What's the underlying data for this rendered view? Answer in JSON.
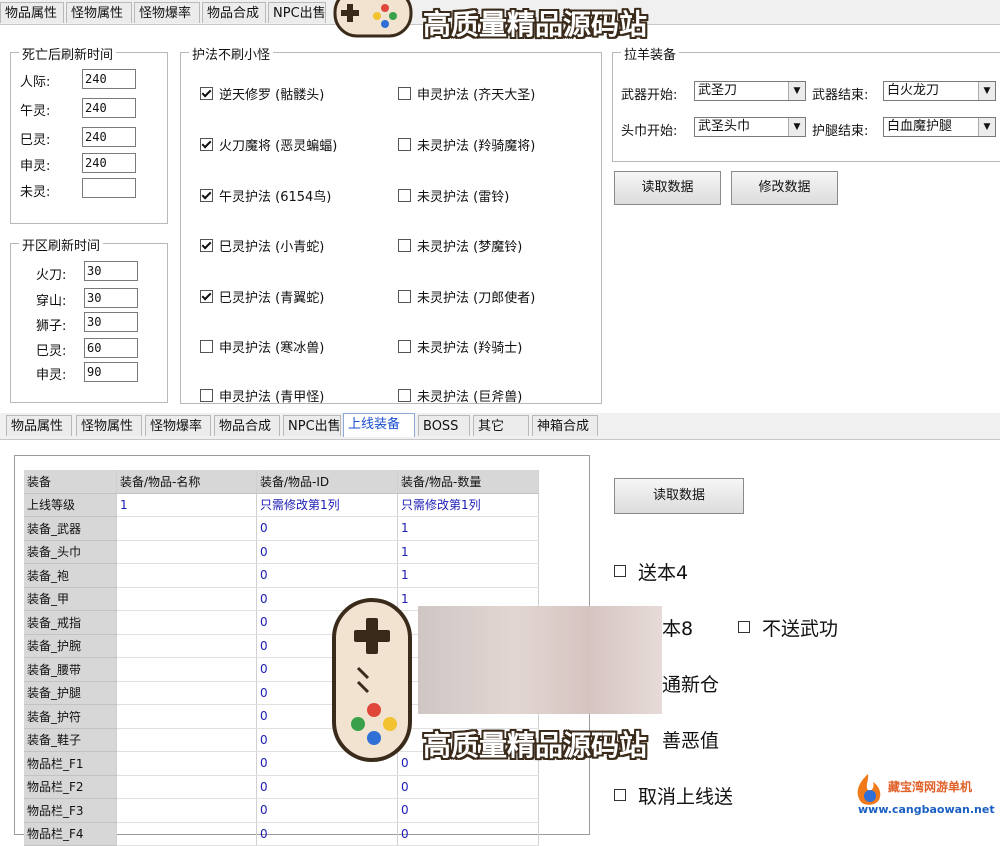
{
  "top_tabs": [
    "物品属性",
    "怪物属性",
    "怪物爆率",
    "物品合成",
    "NPC出售"
  ],
  "death_refresh": {
    "title": "死亡后刷新时间",
    "rows": [
      {
        "label": "人际:",
        "value": "240"
      },
      {
        "label": "午灵:",
        "value": "240"
      },
      {
        "label": "巳灵:",
        "value": "240"
      },
      {
        "label": "申灵:",
        "value": "240"
      },
      {
        "label": "未灵:",
        "value": ""
      }
    ]
  },
  "server_refresh": {
    "title": "开区刷新时间",
    "rows": [
      {
        "label": "火刀:",
        "value": "30"
      },
      {
        "label": "穿山:",
        "value": "30"
      },
      {
        "label": "狮子:",
        "value": "30"
      },
      {
        "label": "巳灵:",
        "value": "60"
      },
      {
        "label": "申灵:",
        "value": "90"
      }
    ]
  },
  "no_minion": {
    "title": "护法不刷小怪",
    "left": [
      {
        "label": "逆天修罗 (骷髅头)",
        "checked": true
      },
      {
        "label": "火刀魔将 (恶灵蝙蝠)",
        "checked": true
      },
      {
        "label": "午灵护法 (6154鸟)",
        "checked": true
      },
      {
        "label": "巳灵护法 (小青蛇)",
        "checked": true
      },
      {
        "label": "巳灵护法 (青翼蛇)",
        "checked": true
      },
      {
        "label": "申灵护法 (寒冰兽)",
        "checked": false
      },
      {
        "label": "申灵护法 (青甲怪)",
        "checked": false
      }
    ],
    "right": [
      {
        "label": "申灵护法 (齐天大圣)",
        "checked": false
      },
      {
        "label": "未灵护法 (羚骑魔将)",
        "checked": false
      },
      {
        "label": "未灵护法 (雷铃)",
        "checked": false
      },
      {
        "label": "未灵护法 (梦魔铃)",
        "checked": false
      },
      {
        "label": "未灵护法 (刀郎使者)",
        "checked": false
      },
      {
        "label": "未灵护法 (羚骑士)",
        "checked": false
      },
      {
        "label": "未灵护法 (巨斧兽)",
        "checked": false
      }
    ]
  },
  "pull_equip": {
    "title": "拉羊装备",
    "weapon_start_label": "武器开始:",
    "weapon_start": "武圣刀",
    "weapon_end_label": "武器结束:",
    "weapon_end": "白火龙刀",
    "head_start_label": "头巾开始:",
    "head_start": "武圣头巾",
    "leg_end_label": "护腿结束:",
    "leg_end": "白血魔护腿",
    "read_btn": "读取数据",
    "modify_btn": "修改数据"
  },
  "bottom_tabs": [
    "物品属性",
    "怪物属性",
    "怪物爆率",
    "物品合成",
    "NPC出售",
    "上线装备",
    "BOSS",
    "其它",
    "神箱合成"
  ],
  "online_equip": {
    "headers": [
      "装备",
      "装备/物品-名称",
      "装备/物品-ID",
      "装备/物品-数量"
    ],
    "rows": [
      [
        "上线等级",
        "1",
        "只需修改第1列",
        "只需修改第1列"
      ],
      [
        "装备_武器",
        "",
        "0",
        "1"
      ],
      [
        "装备_头巾",
        "",
        "0",
        "1"
      ],
      [
        "装备_袍",
        "",
        "0",
        "1"
      ],
      [
        "装备_甲",
        "",
        "0",
        "1"
      ],
      [
        "装备_戒指",
        "",
        "0",
        ""
      ],
      [
        "装备_护腕",
        "",
        "0",
        ""
      ],
      [
        "装备_腰带",
        "",
        "0",
        ""
      ],
      [
        "装备_护腿",
        "",
        "0",
        ""
      ],
      [
        "装备_护符",
        "",
        "0",
        ""
      ],
      [
        "装备_鞋子",
        "",
        "0",
        ""
      ],
      [
        "物品栏_F1",
        "",
        "0",
        "0"
      ],
      [
        "物品栏_F2",
        "",
        "0",
        "0"
      ],
      [
        "物品栏_F3",
        "",
        "0",
        "0"
      ],
      [
        "物品栏_F4",
        "",
        "0",
        "0"
      ]
    ],
    "read_btn": "读取数据",
    "options": [
      {
        "label": "送本4"
      },
      {
        "label": "本8"
      },
      {
        "label": "不送武功"
      },
      {
        "label": "通新仓"
      },
      {
        "label": "善恶值"
      },
      {
        "label": "取消上线送"
      }
    ]
  },
  "watermark": {
    "text": "高质量精品源码站"
  },
  "site_logo": {
    "line1": "藏宝湾网游单机",
    "line2": "www.cangbaowan.net"
  }
}
